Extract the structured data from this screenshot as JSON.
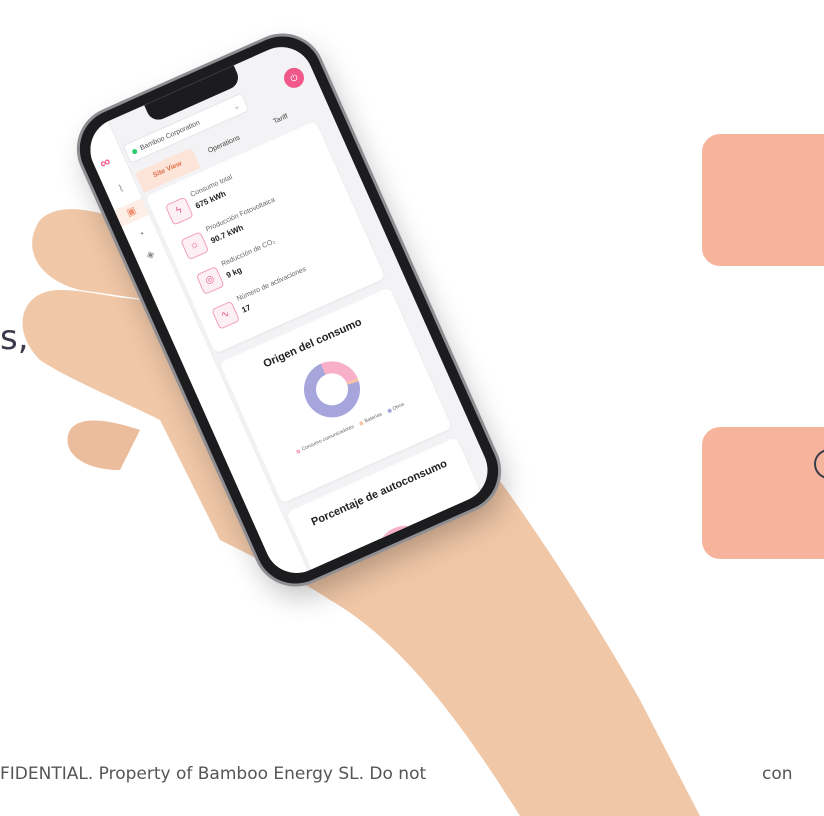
{
  "background": {
    "slide_text_fragment": "s,",
    "footer_left": "FIDENTIAL. Property of Bamboo Energy SL. Do not",
    "footer_right": "con"
  },
  "colors": {
    "accent": "#f0588a",
    "salmon": "#f7b49c",
    "tab_active": "#e0704a"
  },
  "app": {
    "logo": "∞",
    "org_select": {
      "value": "Bamboo Corporation"
    },
    "avatar_icon": "exit-icon",
    "rail_icons": [
      "chart-icon",
      "building-icon",
      "bell-icon",
      "box-icon"
    ],
    "tabs": [
      {
        "label": "Site View",
        "active": true
      },
      {
        "label": "Operations",
        "active": false
      },
      {
        "label": "Tariff",
        "active": false
      }
    ],
    "metrics": [
      {
        "icon": "bolt-icon",
        "label": "Consumo total",
        "value": "675 kWh"
      },
      {
        "icon": "sun-icon",
        "label": "Producción Fotovoltaica",
        "value": "90.7 kWh"
      },
      {
        "icon": "co2-icon",
        "label": "Reducción de CO₂",
        "value": "9 kg"
      },
      {
        "icon": "pulse-icon",
        "label": "Número de activaciones",
        "value": "17"
      }
    ],
    "origin_chart": {
      "title": "Origen del consumo",
      "legend": [
        "Consumo comunicadores",
        "Baterías",
        "Otros"
      ],
      "legend_colors": [
        "#f8b0c8",
        "#f7c4a8",
        "#a6a6dd"
      ]
    },
    "autoconsumo": {
      "title": "Porcentaje de autoconsumo"
    }
  }
}
